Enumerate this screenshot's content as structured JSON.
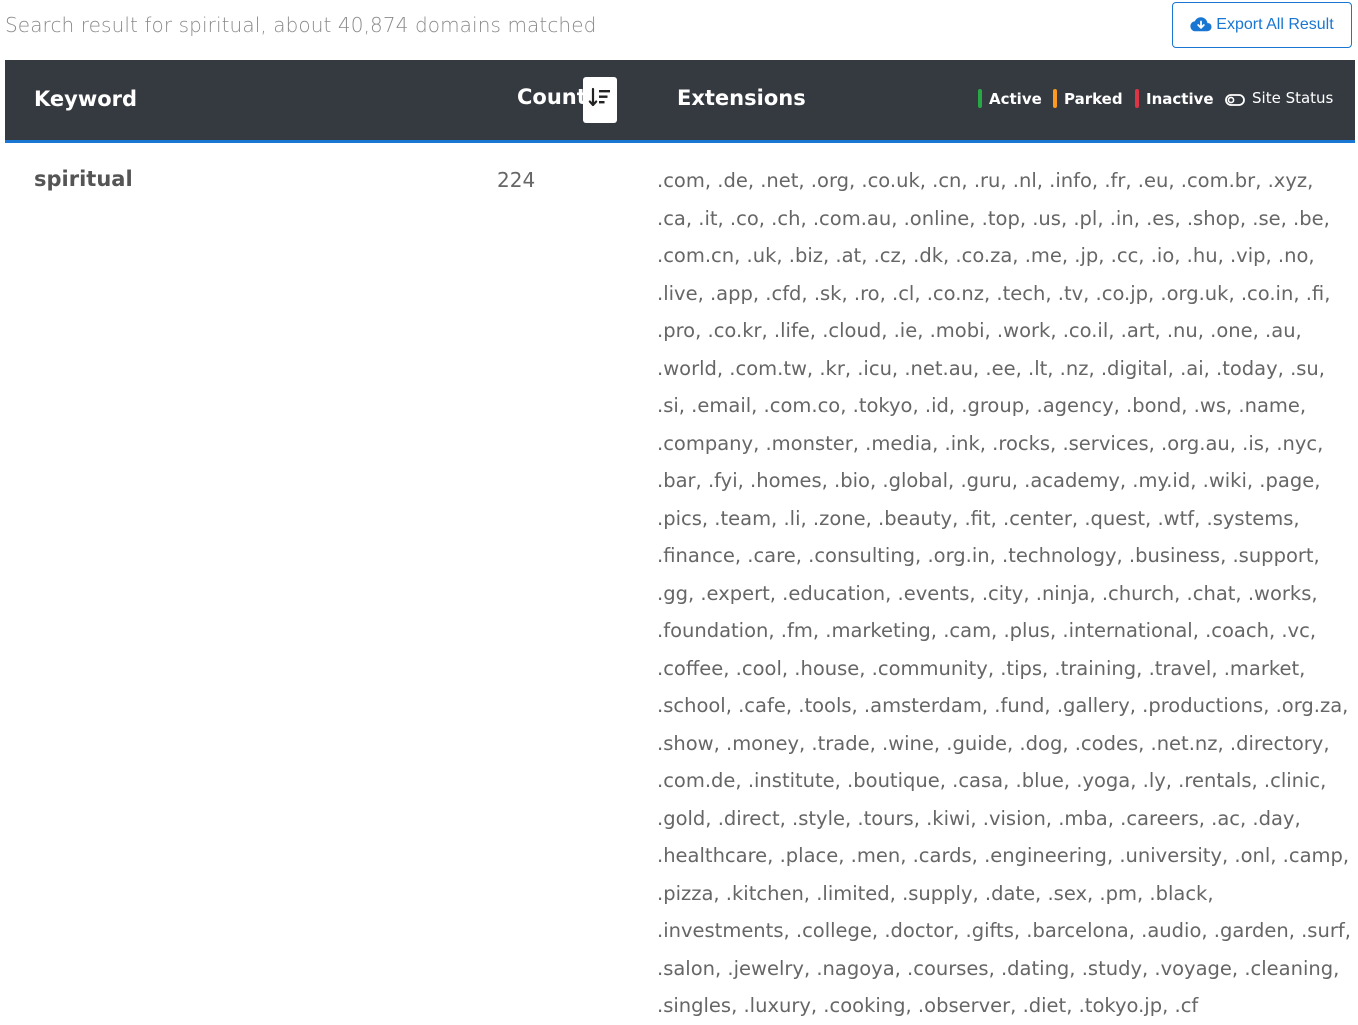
{
  "header": {
    "summary": "Search result for spiritual, about 40,874 domains matched",
    "export_label": "Export All Result",
    "export_icon": "cloud-download-icon"
  },
  "table": {
    "columns": {
      "keyword": "Keyword",
      "count": "Count",
      "extensions": "Extensions"
    },
    "sort_icon": "sort-descending-icon",
    "legend": {
      "active": {
        "label": "Active",
        "color": "#28a745"
      },
      "parked": {
        "label": "Parked",
        "color": "#fd9a1f"
      },
      "inactive": {
        "label": "Inactive",
        "color": "#dc3545"
      },
      "site_status": {
        "label": "Site Status",
        "icon": "toggle-icon"
      }
    },
    "accent_color": "#1976d2",
    "header_bg": "#343a40",
    "rows": [
      {
        "keyword": "spiritual",
        "count": "224",
        "extensions": ".com, .de, .net, .org, .co.uk, .cn, .ru, .nl, .info, .fr, .eu, .com.br, .xyz, .ca, .it, .co, .ch, .com.au, .online, .top, .us, .pl, .in, .es, .shop, .se, .be, .com.cn, .uk, .biz, .at, .cz, .dk, .co.za, .me, .jp, .cc, .io, .hu, .vip, .no, .live, .app, .cfd, .sk, .ro, .cl, .co.nz, .tech, .tv, .co.jp, .org.uk, .co.in, .fi, .pro, .co.kr, .life, .cloud, .ie, .mobi, .work, .co.il, .art, .nu, .one, .au, .world, .com.tw, .kr, .icu, .net.au, .ee, .lt, .nz, .digital, .ai, .today, .su, .si, .email, .com.co, .tokyo, .id, .group, .agency, .bond, .ws, .name, .company, .monster, .media, .ink, .rocks, .services, .org.au, .is, .nyc, .bar, .fyi, .homes, .bio, .global, .guru, .academy, .my.id, .wiki, .page, .pics, .team, .li, .zone, .beauty, .fit, .center, .quest, .wtf, .systems, .finance, .care, .consulting, .org.in, .technology, .business, .support, .gg, .expert, .education, .events, .city, .ninja, .church, .chat, .works, .foundation, .fm, .marketing, .cam, .plus, .international, .coach, .vc, .coffee, .cool, .house, .community, .tips, .training, .travel, .market, .school, .cafe, .tools, .amsterdam, .fund, .gallery, .productions, .org.za, .show, .money, .trade, .wine, .guide, .dog, .codes, .net.nz, .directory, .com.de, .institute, .boutique, .casa, .blue, .yoga, .ly, .rentals, .clinic, .gold, .direct, .style, .tours, .kiwi, .vision, .mba, .careers, .ac, .day, .healthcare, .place, .men, .cards, .engineering, .university, .onl, .camp, .pizza, .kitchen, .limited, .supply, .date, .sex, .pm, .black, .investments, .college, .doctor, .gifts, .barcelona, .audio, .garden, .surf, .salon, .jewelry, .nagoya, .courses, .dating, .study, .voyage, .cleaning, .singles, .luxury, .cooking, .observer, .diet, .tokyo.jp, .cf"
      }
    ]
  }
}
